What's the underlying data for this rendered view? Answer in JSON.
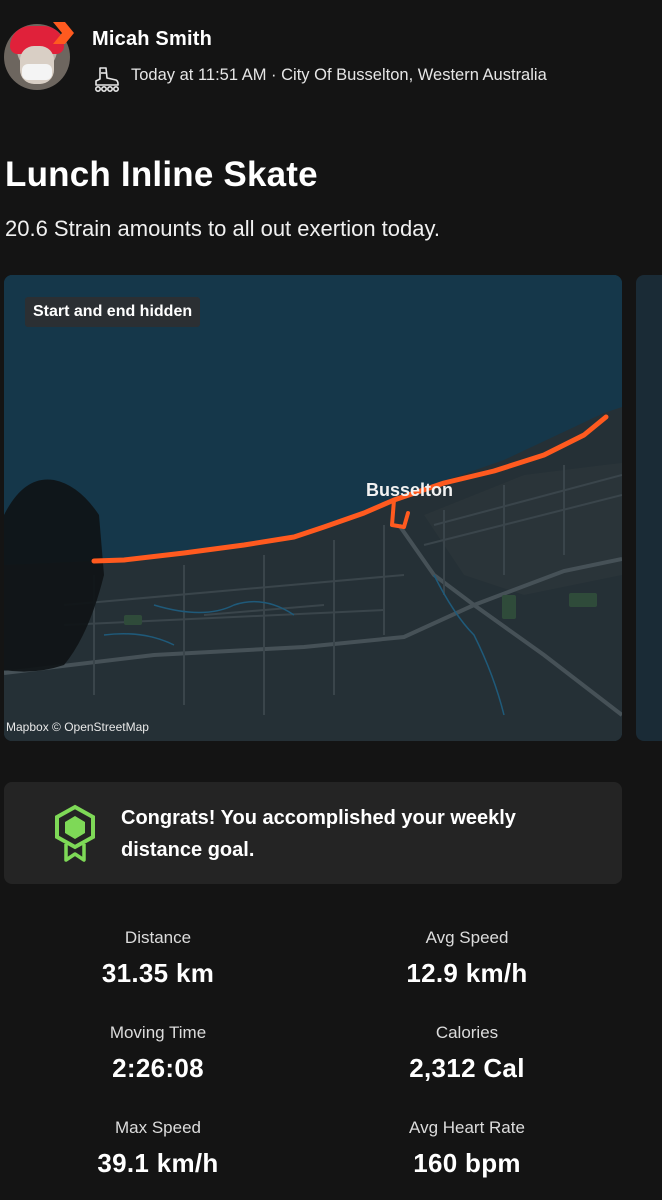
{
  "header": {
    "user_name": "Micah Smith",
    "meta": "Today at 11:51 AM · City Of Busselton, Western Australia",
    "activity_icon": "inline-skate-icon",
    "badge_icon": "chevron-badge-icon"
  },
  "activity": {
    "title": "Lunch Inline Skate",
    "subtitle": "20.6 Strain amounts to all out exertion today."
  },
  "map": {
    "badge": "Start and end hidden",
    "place_label": "Busselton",
    "attribution": "Mapbox © OpenStreetMap",
    "route_color": "#ff5a1f"
  },
  "congrats": {
    "text": "Congrats! You accomplished your weekly distance goal.",
    "icon": "goal-medal-icon",
    "icon_color": "#7ed957"
  },
  "stats": [
    {
      "label": "Distance",
      "value": "31.35 km"
    },
    {
      "label": "Avg Speed",
      "value": "12.9 km/h"
    },
    {
      "label": "Moving Time",
      "value": "2:26:08"
    },
    {
      "label": "Calories",
      "value": "2,312 Cal"
    },
    {
      "label": "Max Speed",
      "value": "39.1 km/h"
    },
    {
      "label": "Avg Heart Rate",
      "value": "160 bpm"
    }
  ]
}
